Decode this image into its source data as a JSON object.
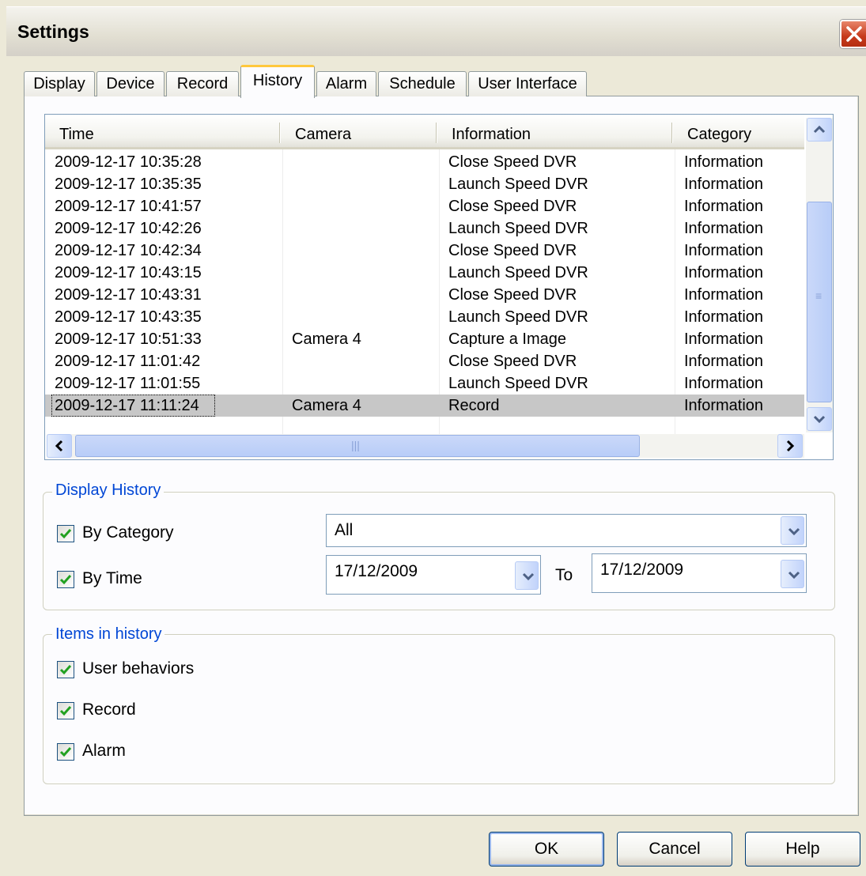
{
  "window": {
    "title": "Settings"
  },
  "tabs": [
    {
      "label": "Display"
    },
    {
      "label": "Device"
    },
    {
      "label": "Record"
    },
    {
      "label": "History",
      "active": true
    },
    {
      "label": "Alarm"
    },
    {
      "label": "Schedule"
    },
    {
      "label": "User Interface"
    }
  ],
  "history_table": {
    "columns": [
      "Time",
      "Camera",
      "Information",
      "Category"
    ],
    "rows": [
      {
        "time": "2009-12-17 10:35:28",
        "camera": "",
        "information": "Close Speed DVR",
        "category": "Information"
      },
      {
        "time": "2009-12-17 10:35:35",
        "camera": "",
        "information": "Launch Speed DVR",
        "category": "Information"
      },
      {
        "time": "2009-12-17 10:41:57",
        "camera": "",
        "information": "Close Speed DVR",
        "category": "Information"
      },
      {
        "time": "2009-12-17 10:42:26",
        "camera": "",
        "information": "Launch Speed DVR",
        "category": "Information"
      },
      {
        "time": "2009-12-17 10:42:34",
        "camera": "",
        "information": "Close Speed DVR",
        "category": "Information"
      },
      {
        "time": "2009-12-17 10:43:15",
        "camera": "",
        "information": "Launch Speed DVR",
        "category": "Information"
      },
      {
        "time": "2009-12-17 10:43:31",
        "camera": "",
        "information": "Close Speed DVR",
        "category": "Information"
      },
      {
        "time": "2009-12-17 10:43:35",
        "camera": "",
        "information": "Launch Speed DVR",
        "category": "Information"
      },
      {
        "time": "2009-12-17 10:51:33",
        "camera": "Camera 4",
        "information": "Capture a Image",
        "category": "Information"
      },
      {
        "time": "2009-12-17 11:01:42",
        "camera": "",
        "information": "Close Speed DVR",
        "category": "Information"
      },
      {
        "time": "2009-12-17 11:01:55",
        "camera": "",
        "information": "Launch Speed DVR",
        "category": "Information"
      },
      {
        "time": "2009-12-17 11:11:24",
        "camera": "Camera 4",
        "information": "Record",
        "category": "Information",
        "selected": true
      }
    ]
  },
  "display_history": {
    "title": "Display History",
    "by_category": {
      "label": "By Category",
      "checked": true,
      "value": "All"
    },
    "by_time": {
      "label": "By Time",
      "checked": true,
      "from": "17/12/2009",
      "to_label": "To",
      "to": "17/12/2009"
    }
  },
  "items_in_history": {
    "title": "Items in history",
    "items": [
      {
        "label": "User behaviors",
        "checked": true
      },
      {
        "label": "Record",
        "checked": true
      },
      {
        "label": "Alarm",
        "checked": true
      }
    ]
  },
  "buttons": {
    "ok": "OK",
    "cancel": "Cancel",
    "help": "Help"
  },
  "colors": {
    "accent_blue": "#0046d5",
    "check_green": "#21a121",
    "close_red": "#c6391b",
    "tab_highlight": "#ffc83c"
  }
}
